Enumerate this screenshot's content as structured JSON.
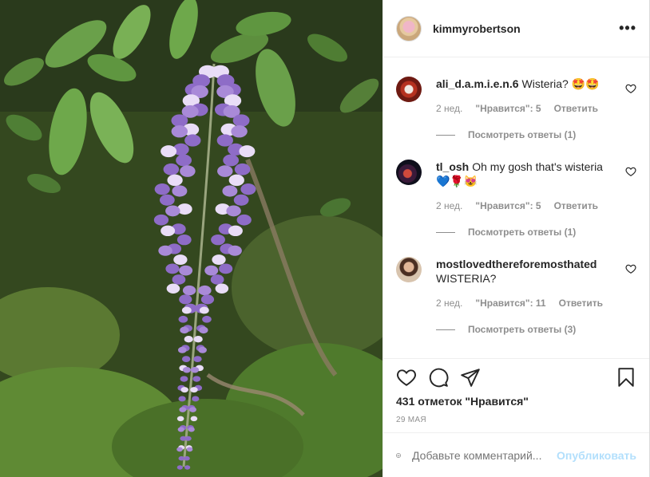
{
  "post": {
    "username": "kimmyrobertson",
    "more_icon": "•••",
    "likes_text": "431 отметок \"Нравится\"",
    "date": "29 МАЯ"
  },
  "comments": [
    {
      "username": "ali_d.a.m.i.e.n.6",
      "text": "Wisteria? 🤩🤩",
      "age": "2 нед.",
      "likes": "\"Нравится\": 5",
      "reply": "Ответить",
      "view_replies": "Посмотреть ответы (1)"
    },
    {
      "username": "tl_osh",
      "text": "Oh my gosh that's wisteria 💙🌹😻",
      "age": "2 нед.",
      "likes": "\"Нравится\": 5",
      "reply": "Ответить",
      "view_replies": "Посмотреть ответы (1)"
    },
    {
      "username": "mostlovedthereforemosthated",
      "text": "WISTERIA?",
      "age": "2 нед.",
      "likes": "\"Нравится\": 11",
      "reply": "Ответить",
      "view_replies": "Посмотреть ответы (3)"
    }
  ],
  "add_comment": {
    "placeholder": "Добавьте комментарий...",
    "post_label": "Опубликовать"
  },
  "icons": [
    "heart-icon",
    "comment-icon",
    "share-icon",
    "bookmark-icon",
    "emoji-icon",
    "more-icon"
  ],
  "colors": {
    "post_disabled": "#b2dffc",
    "muted": "#8e8e8e",
    "text": "#262626"
  }
}
